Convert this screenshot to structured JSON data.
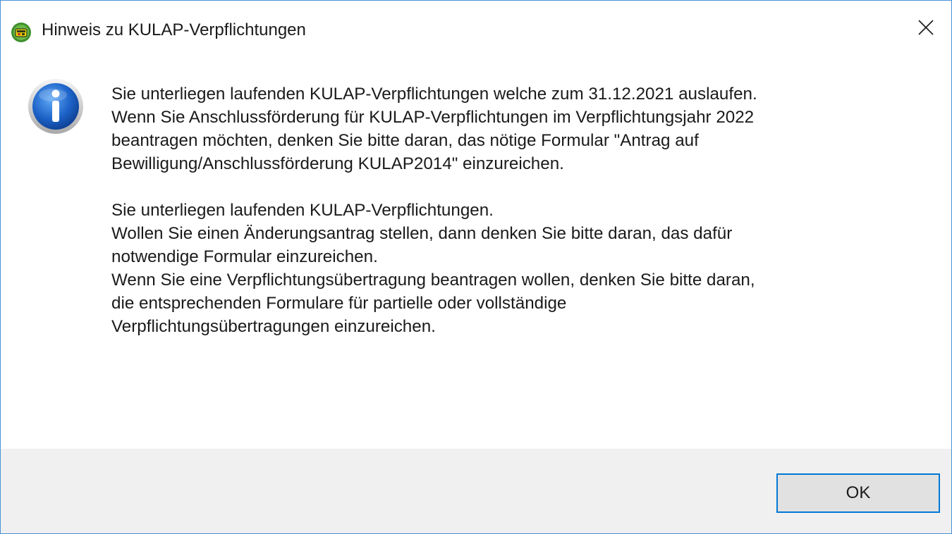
{
  "window": {
    "title": "Hinweis zu KULAP-Verpflichtungen",
    "app_icon": "kulap-app-icon",
    "close_icon": "close-icon"
  },
  "message": {
    "icon": "info-icon",
    "paragraphs": [
      "Sie unterliegen laufenden KULAP-Verpflichtungen welche zum 31.12.2021 auslaufen.\nWenn Sie Anschlussförderung für KULAP-Verpflichtungen im Verpflichtungsjahr 2022\nbeantragen möchten, denken Sie bitte daran, das nötige Formular \"Antrag auf\nBewilligung/Anschlussförderung KULAP2014\" einzureichen.",
      "Sie unterliegen laufenden KULAP-Verpflichtungen.\nWollen Sie einen Änderungsantrag stellen, dann denken Sie bitte daran, das dafür\nnotwendige Formular einzureichen.\nWenn Sie eine Verpflichtungsübertragung beantragen wollen, denken Sie bitte daran,\ndie entsprechenden Formulare für partielle oder vollständige\nVerpflichtungsübertragungen einzureichen."
    ]
  },
  "buttons": {
    "ok_label": "OK"
  },
  "colors": {
    "accent": "#0078d7",
    "window_border": "#4a90d9",
    "button_face": "#e1e1e1",
    "footer_background": "#f0f0f0"
  }
}
